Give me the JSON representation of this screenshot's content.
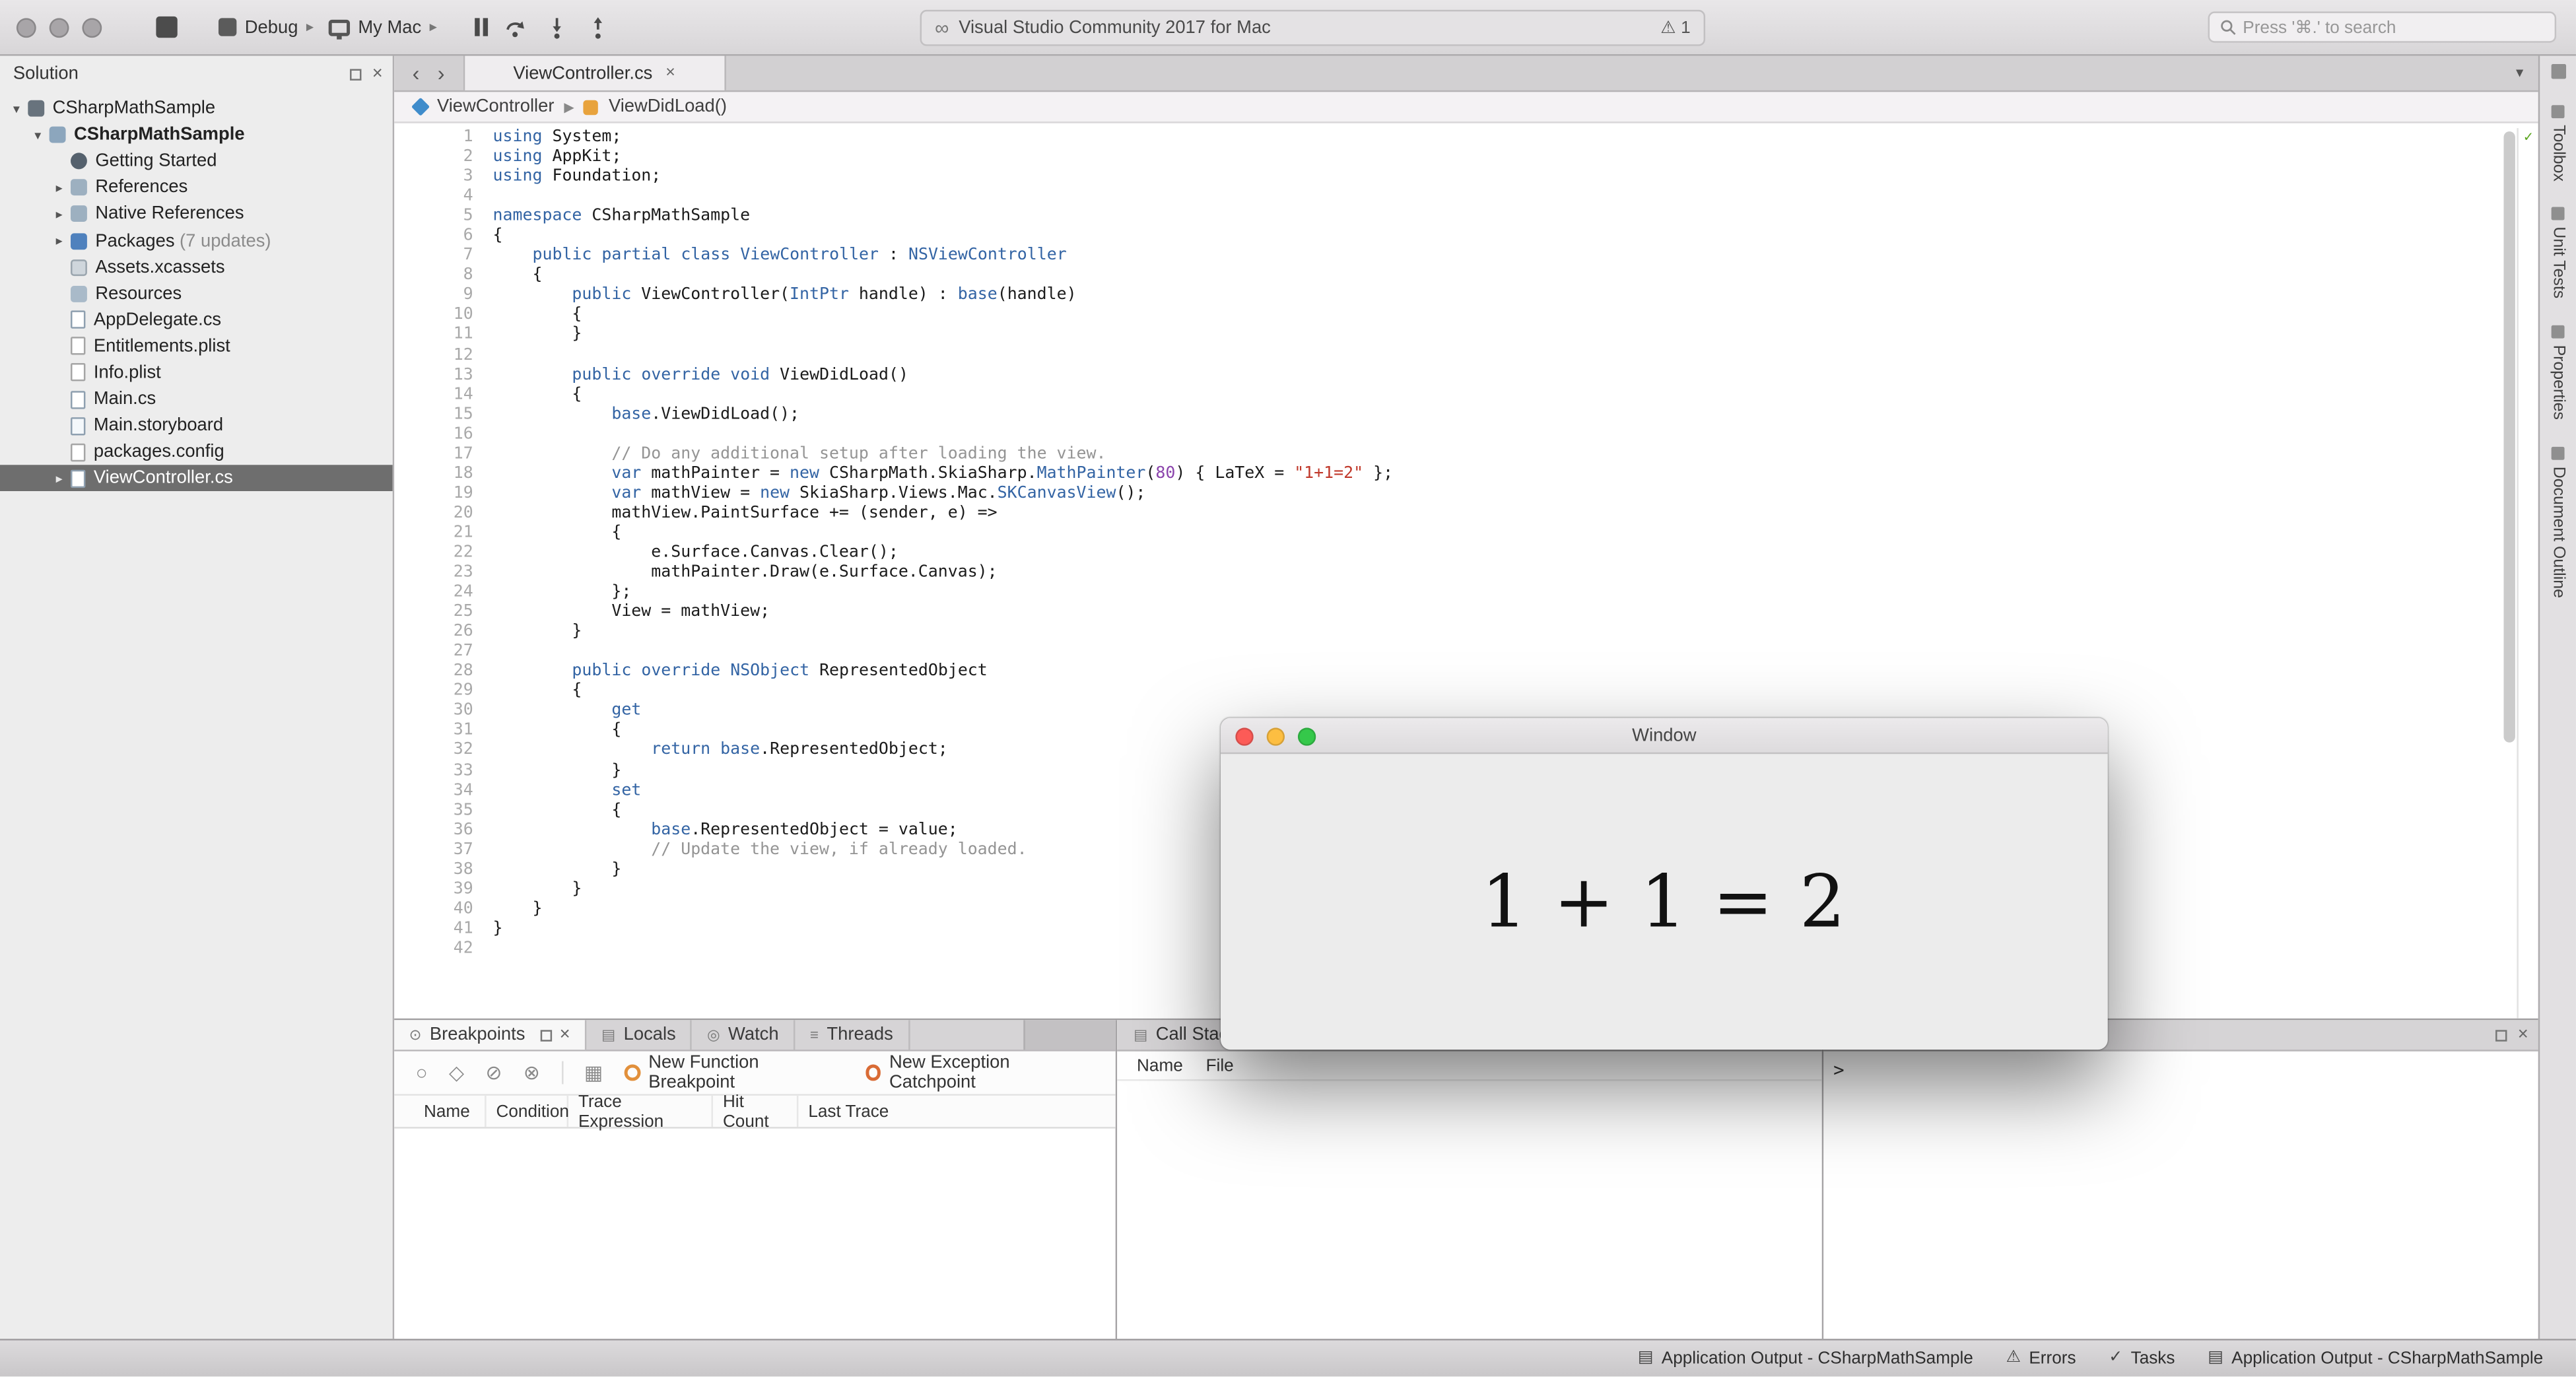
{
  "toolbar": {
    "debug_config": "Debug",
    "target": "My Mac",
    "window_title": "Visual Studio Community 2017 for Mac",
    "warning_count": "1",
    "search_placeholder": "Press '⌘.' to search"
  },
  "solution_pad": {
    "title": "Solution",
    "items": [
      {
        "label": "CSharpMathSample",
        "indent": 0,
        "disclosure": "open",
        "icon": "solution"
      },
      {
        "label": "CSharpMathSample",
        "indent": 1,
        "disclosure": "open",
        "icon": "project",
        "bold": true
      },
      {
        "label": "Getting Started",
        "indent": 2,
        "disclosure": "none",
        "icon": "getting-started"
      },
      {
        "label": "References",
        "indent": 2,
        "disclosure": "closed",
        "icon": "references"
      },
      {
        "label": "Native References",
        "indent": 2,
        "disclosure": "closed",
        "icon": "references"
      },
      {
        "label": "Packages",
        "suffix": "(7 updates)",
        "indent": 2,
        "disclosure": "closed",
        "icon": "packages"
      },
      {
        "label": "Assets.xcassets",
        "indent": 2,
        "disclosure": "none",
        "icon": "assets"
      },
      {
        "label": "Resources",
        "indent": 2,
        "disclosure": "none",
        "icon": "folder"
      },
      {
        "label": "AppDelegate.cs",
        "indent": 2,
        "disclosure": "none",
        "icon": "csfile"
      },
      {
        "label": "Entitlements.plist",
        "indent": 2,
        "disclosure": "none",
        "icon": "plist"
      },
      {
        "label": "Info.plist",
        "indent": 2,
        "disclosure": "none",
        "icon": "plist"
      },
      {
        "label": "Main.cs",
        "indent": 2,
        "disclosure": "none",
        "icon": "csfile"
      },
      {
        "label": "Main.storyboard",
        "indent": 2,
        "disclosure": "none",
        "icon": "storyboard"
      },
      {
        "label": "packages.config",
        "indent": 2,
        "disclosure": "none",
        "icon": "config"
      },
      {
        "label": "ViewController.cs",
        "indent": 2,
        "disclosure": "closed",
        "icon": "csfile",
        "selected": true
      }
    ]
  },
  "editor": {
    "tab_label": "ViewController.cs",
    "breadcrumb": [
      "ViewController",
      "ViewDidLoad()"
    ],
    "lines": [
      [
        [
          "k",
          "using"
        ],
        [
          "p",
          " System;"
        ]
      ],
      [
        [
          "k",
          "using"
        ],
        [
          "p",
          " AppKit;"
        ]
      ],
      [
        [
          "k",
          "using"
        ],
        [
          "p",
          " Foundation;"
        ]
      ],
      [],
      [
        [
          "k",
          "namespace"
        ],
        [
          "p",
          " CSharpMathSample"
        ]
      ],
      [
        [
          "p",
          "{"
        ]
      ],
      [
        [
          "p",
          "    "
        ],
        [
          "k",
          "public"
        ],
        [
          "p",
          " "
        ],
        [
          "k",
          "partial"
        ],
        [
          "p",
          " "
        ],
        [
          "k",
          "class"
        ],
        [
          "p",
          " "
        ],
        [
          "t",
          "ViewController"
        ],
        [
          "p",
          " : "
        ],
        [
          "t",
          "NSViewController"
        ]
      ],
      [
        [
          "p",
          "    {"
        ]
      ],
      [
        [
          "p",
          "        "
        ],
        [
          "k",
          "public"
        ],
        [
          "p",
          " ViewController("
        ],
        [
          "t",
          "IntPtr"
        ],
        [
          "p",
          " handle) : "
        ],
        [
          "k",
          "base"
        ],
        [
          "p",
          "(handle)"
        ]
      ],
      [
        [
          "p",
          "        {"
        ]
      ],
      [
        [
          "p",
          "        }"
        ]
      ],
      [],
      [
        [
          "p",
          "        "
        ],
        [
          "k",
          "public"
        ],
        [
          "p",
          " "
        ],
        [
          "k",
          "override"
        ],
        [
          "p",
          " "
        ],
        [
          "k",
          "void"
        ],
        [
          "p",
          " ViewDidLoad()"
        ]
      ],
      [
        [
          "p",
          "        {"
        ]
      ],
      [
        [
          "p",
          "            "
        ],
        [
          "k",
          "base"
        ],
        [
          "p",
          ".ViewDidLoad();"
        ]
      ],
      [],
      [
        [
          "p",
          "            "
        ],
        [
          "c",
          "// Do any additional setup after loading the view."
        ]
      ],
      [
        [
          "p",
          "            "
        ],
        [
          "k",
          "var"
        ],
        [
          "p",
          " mathPainter = "
        ],
        [
          "k",
          "new"
        ],
        [
          "p",
          " CSharpMath.SkiaSharp."
        ],
        [
          "t",
          "MathPainter"
        ],
        [
          "p",
          "("
        ],
        [
          "n",
          "80"
        ],
        [
          "p",
          ") { LaTeX = "
        ],
        [
          "s",
          "\"1+1=2\""
        ],
        [
          "p",
          " };"
        ]
      ],
      [
        [
          "p",
          "            "
        ],
        [
          "k",
          "var"
        ],
        [
          "p",
          " mathView = "
        ],
        [
          "k",
          "new"
        ],
        [
          "p",
          " SkiaSharp.Views.Mac."
        ],
        [
          "t",
          "SKCanvasView"
        ],
        [
          "p",
          "();"
        ]
      ],
      [
        [
          "p",
          "            mathView.PaintSurface += (sender, e) =>"
        ]
      ],
      [
        [
          "p",
          "            {"
        ]
      ],
      [
        [
          "p",
          "                e.Surface.Canvas.Clear();"
        ]
      ],
      [
        [
          "p",
          "                mathPainter.Draw(e.Surface.Canvas);"
        ]
      ],
      [
        [
          "p",
          "            };"
        ]
      ],
      [
        [
          "p",
          "            View = mathView;"
        ]
      ],
      [
        [
          "p",
          "        }"
        ]
      ],
      [],
      [
        [
          "p",
          "        "
        ],
        [
          "k",
          "public"
        ],
        [
          "p",
          " "
        ],
        [
          "k",
          "override"
        ],
        [
          "p",
          " "
        ],
        [
          "t",
          "NSObject"
        ],
        [
          "p",
          " RepresentedObject"
        ]
      ],
      [
        [
          "p",
          "        {"
        ]
      ],
      [
        [
          "p",
          "            "
        ],
        [
          "k",
          "get"
        ]
      ],
      [
        [
          "p",
          "            {"
        ]
      ],
      [
        [
          "p",
          "                "
        ],
        [
          "k",
          "return"
        ],
        [
          "p",
          " "
        ],
        [
          "k",
          "base"
        ],
        [
          "p",
          ".RepresentedObject;"
        ]
      ],
      [
        [
          "p",
          "            }"
        ]
      ],
      [
        [
          "p",
          "            "
        ],
        [
          "k",
          "set"
        ]
      ],
      [
        [
          "p",
          "            {"
        ]
      ],
      [
        [
          "p",
          "                "
        ],
        [
          "k",
          "base"
        ],
        [
          "p",
          ".RepresentedObject = value;"
        ]
      ],
      [
        [
          "p",
          "                "
        ],
        [
          "c",
          "// Update the view, if already loaded."
        ]
      ],
      [
        [
          "p",
          "            }"
        ]
      ],
      [
        [
          "p",
          "        }"
        ]
      ],
      [
        [
          "p",
          "    }"
        ]
      ],
      [
        [
          "p",
          "}"
        ]
      ],
      []
    ]
  },
  "bottom": {
    "breakpoints": {
      "tabs": [
        "Breakpoints",
        "Locals",
        "Watch",
        "Threads"
      ],
      "new_function": "New Function Breakpoint",
      "new_exception": "New Exception Catchpoint",
      "columns": [
        "Name",
        "Condition",
        "Trace Expression",
        "Hit Count",
        "Last Trace"
      ]
    },
    "call_stack": {
      "title": "Call Stack",
      "columns": [
        "Name",
        "File"
      ]
    },
    "immediate": {
      "prompt": ">"
    }
  },
  "right_tabs": [
    "Toolbox",
    "Unit Tests",
    "Properties",
    "Document Outline"
  ],
  "statusbar": {
    "items": [
      {
        "label": "Application Output - CSharpMathSample"
      },
      {
        "label": "Errors"
      },
      {
        "label": "Tasks"
      },
      {
        "label": "Application Output - CSharpMathSample"
      }
    ]
  },
  "float_window": {
    "title": "Window",
    "math": "1 + 1 = 2"
  }
}
